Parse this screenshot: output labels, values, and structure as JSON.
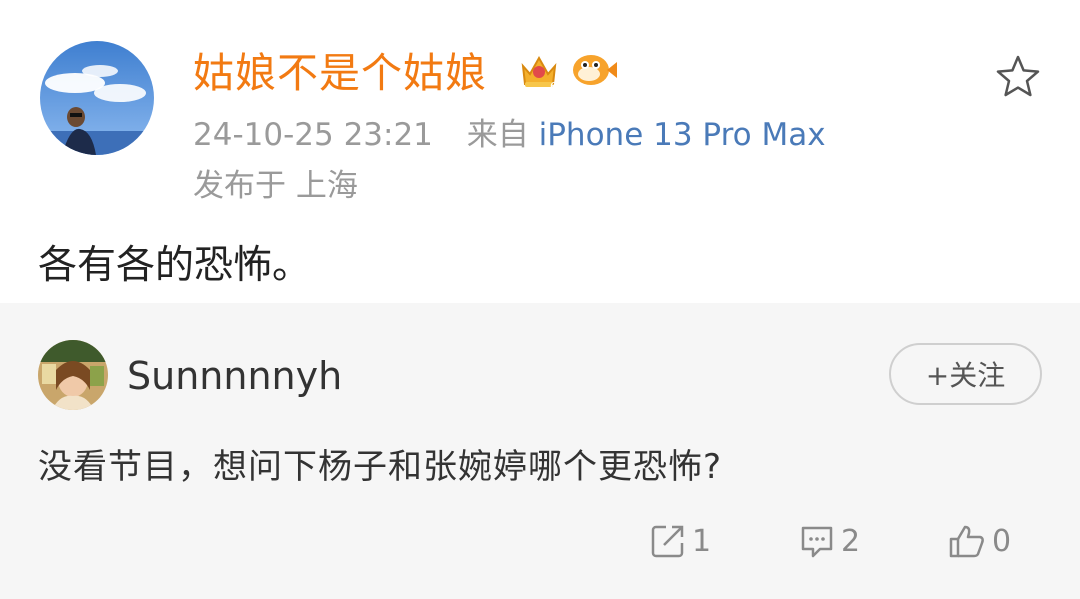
{
  "post": {
    "username": "姑娘不是个姑娘",
    "timestamp": "24-10-25 23:21",
    "source_prefix": "来自",
    "device": "iPhone 13 Pro Max",
    "location": "发布于 上海",
    "content": "各有各的恐怖。",
    "icons": {
      "avatar": "avatar-photo",
      "badge_level": "crown-badge-icon",
      "badge_fan": "pufferfish-badge-icon",
      "favorite": "star-icon"
    }
  },
  "repost": {
    "username": "Sunnnnnyh",
    "follow_label": "+关注",
    "content": "没看节目，想问下杨子和张婉婷哪个更恐怖?",
    "actions": {
      "share_count": "1",
      "comment_count": "2",
      "like_count": "0"
    }
  },
  "colors": {
    "username_orange": "#f27a12",
    "link_blue": "#4a7ab8",
    "meta_gray": "#9a9a9a",
    "repost_bg": "#f6f6f6"
  }
}
